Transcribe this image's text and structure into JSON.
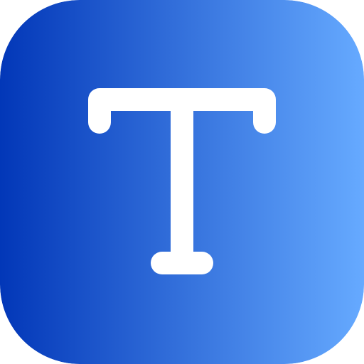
{
  "icon": {
    "name": "text-tool-icon",
    "glyph": "T",
    "colors": {
      "gradient_start": "#0237B8",
      "gradient_end": "#66AAFF",
      "glyph": "#FFFFFF"
    }
  }
}
